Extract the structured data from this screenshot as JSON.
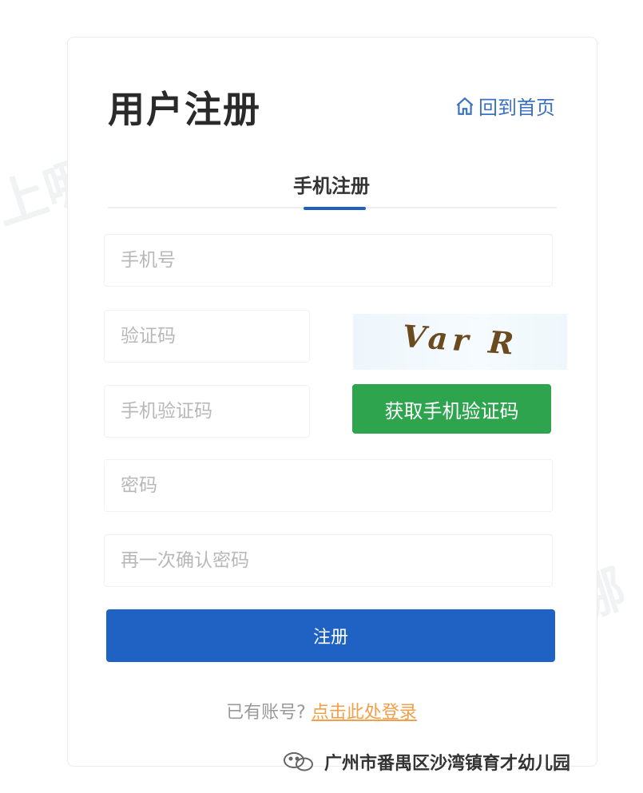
{
  "header": {
    "title": "用户注册",
    "home_link": "回到首页"
  },
  "tabs": [
    {
      "label": "手机注册",
      "active": true
    }
  ],
  "form": {
    "phone_placeholder": "手机号",
    "captcha_placeholder": "验证码",
    "captcha_text": "Var R",
    "sms_code_placeholder": "手机验证码",
    "sms_button": "获取手机验证码",
    "password_placeholder": "密码",
    "confirm_password_placeholder": "再一次确认密码",
    "submit": "注册"
  },
  "footer": {
    "prompt": "已有账号?",
    "login_link": "点击此处登录"
  },
  "watermark": "上哪学",
  "source_account": "广州市番禺区沙湾镇育才幼儿园",
  "colors": {
    "primary": "#1f62c4",
    "success": "#2ea44f",
    "link": "#f0a04a",
    "home_link": "#3a72c0"
  }
}
